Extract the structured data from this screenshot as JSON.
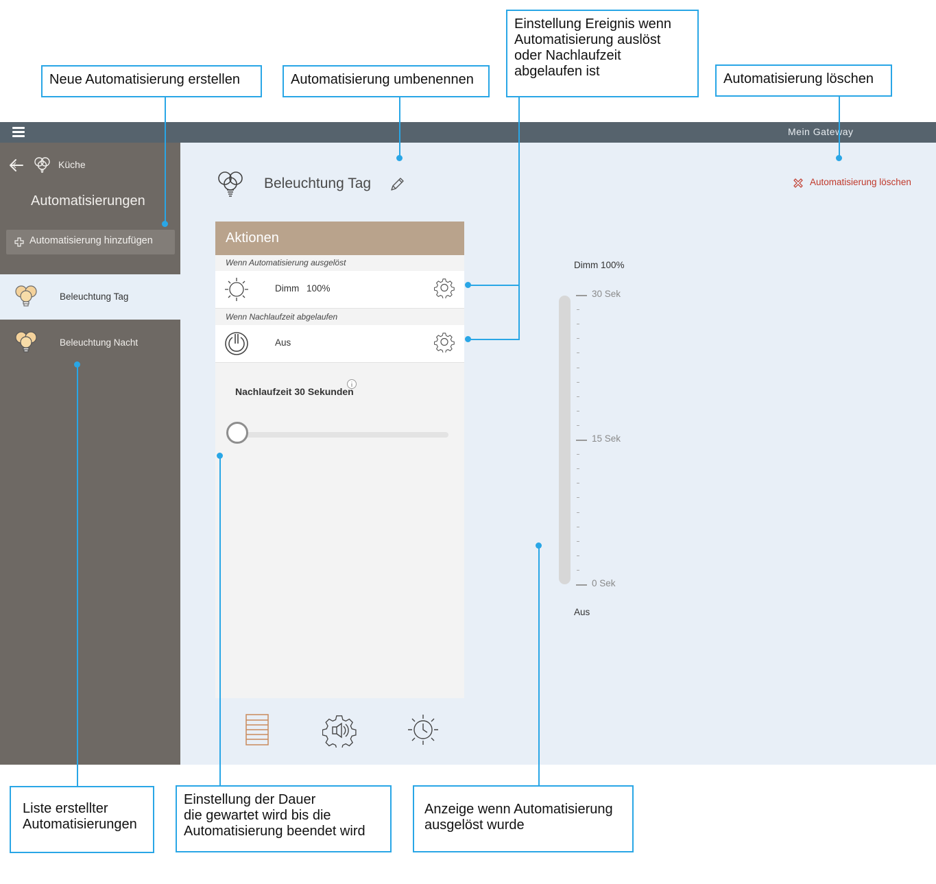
{
  "topbar": {
    "gateway": "Mein Gateway"
  },
  "sidebar": {
    "room": "Küche",
    "title": "Automatisierungen",
    "add_button": "Automatisierung hinzufügen",
    "items": [
      {
        "label": "Beleuchtung Tag",
        "selected": true
      },
      {
        "label": "Beleuchtung Nacht",
        "selected": false
      }
    ]
  },
  "main": {
    "title": "Beleuchtung Tag",
    "delete": "Automatisierung löschen",
    "actions": {
      "header": "Aktionen",
      "trigger_caption": "Wenn Automatisierung ausgelöst",
      "trigger_action": {
        "label": "Dimm",
        "value": "100%"
      },
      "expire_caption": "Wenn Nachlaufzeit abgelaufen",
      "expire_action": {
        "label": "Aus"
      },
      "runtime_label": "Nachlaufzeit 30 Sekunden",
      "runtime_fraction": 0
    },
    "timeline": {
      "top_label": "Dimm 100%",
      "ticks": [
        "30 Sek",
        "15 Sek",
        "0 Sek"
      ],
      "bottom_label": "Aus"
    }
  },
  "annotations": {
    "new": "Neue Automatisierung erstellen",
    "rename": "Automatisierung umbenennen",
    "event": [
      "Einstellung Ereignis wenn",
      "Automatisierung auslöst",
      "oder Nachlaufzeit",
      "abgelaufen ist"
    ],
    "delete": "Automatisierung löschen",
    "list": [
      "Liste erstellter",
      "Automatisierungen"
    ],
    "duration": [
      "Einstellung der Dauer",
      "die gewartet wird bis die",
      "Automatisierung beendet wird"
    ],
    "display": [
      "Anzeige wenn Automatisierung",
      "ausgelöst wurde"
    ]
  },
  "colors": {
    "topbar": "#56636d",
    "sidebar": "#6e6964",
    "main_bg": "#e8eff7",
    "card_header": "#b9a38c",
    "delete": "#c0392b",
    "annotation": "#29a6e6"
  },
  "icons": [
    "menu-icon",
    "back-arrow-icon",
    "bulbs-icon",
    "plus-icon",
    "pencil-icon",
    "close-x-icon",
    "sun-icon",
    "power-icon",
    "gear-icon",
    "info-icon",
    "list-icon",
    "sensor-gear-icon",
    "sun-clock-icon"
  ]
}
